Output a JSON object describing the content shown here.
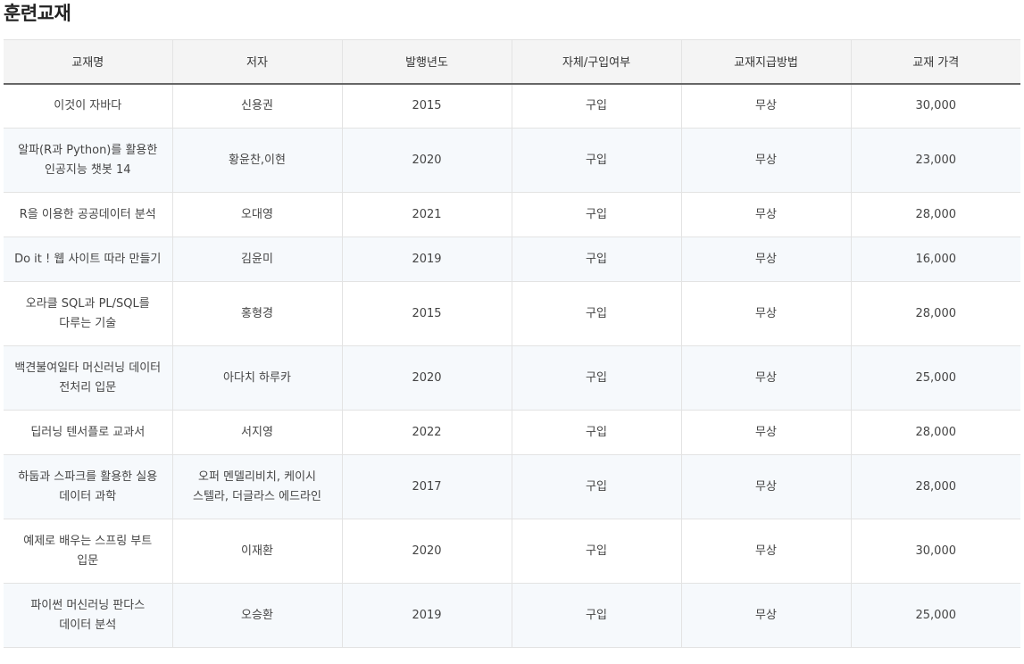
{
  "page": {
    "title": "훈련교재"
  },
  "table": {
    "headers": [
      "교재명",
      "저자",
      "발행년도",
      "자체/구입여부",
      "교재지급방법",
      "교재 가격"
    ],
    "rows": [
      {
        "name": "이것이 자바다",
        "author": "신용권",
        "year": "2015",
        "acquisition": "구입",
        "supply": "무상",
        "price": "30,000"
      },
      {
        "name": "알파(R과 Python)를 활용한 인공지능 챗봇 14",
        "author": "황윤찬,이현",
        "year": "2020",
        "acquisition": "구입",
        "supply": "무상",
        "price": "23,000"
      },
      {
        "name": "R을 이용한 공공데이터 분석",
        "author": "오대영",
        "year": "2021",
        "acquisition": "구입",
        "supply": "무상",
        "price": "28,000"
      },
      {
        "name": "Do it ! 웹 사이트 따라 만들기",
        "author": "김윤미",
        "year": "2019",
        "acquisition": "구입",
        "supply": "무상",
        "price": "16,000"
      },
      {
        "name": "오라클 SQL과 PL/SQL를 다루는 기술",
        "author": "홍형경",
        "year": "2015",
        "acquisition": "구입",
        "supply": "무상",
        "price": "28,000"
      },
      {
        "name": "백견불여일타 머신러닝 데이터 전처리 입문",
        "author": "아다치 하루카",
        "year": "2020",
        "acquisition": "구입",
        "supply": "무상",
        "price": "25,000"
      },
      {
        "name": "딥러닝 텐서플로 교과서",
        "author": "서지영",
        "year": "2022",
        "acquisition": "구입",
        "supply": "무상",
        "price": "28,000"
      },
      {
        "name": "하둡과 스파크를 활용한 실용 데이터 과학",
        "author": "오퍼 멘델리비치, 케이시 스텔라, 더글라스 에드라인",
        "year": "2017",
        "acquisition": "구입",
        "supply": "무상",
        "price": "28,000"
      },
      {
        "name": "예제로 배우는 스프링 부트 입문",
        "author": "이재환",
        "year": "2020",
        "acquisition": "구입",
        "supply": "무상",
        "price": "30,000"
      },
      {
        "name": "파이썬 머신러닝 판다스 데이터 분석",
        "author": "오승환",
        "year": "2019",
        "acquisition": "구입",
        "supply": "무상",
        "price": "25,000"
      }
    ]
  }
}
